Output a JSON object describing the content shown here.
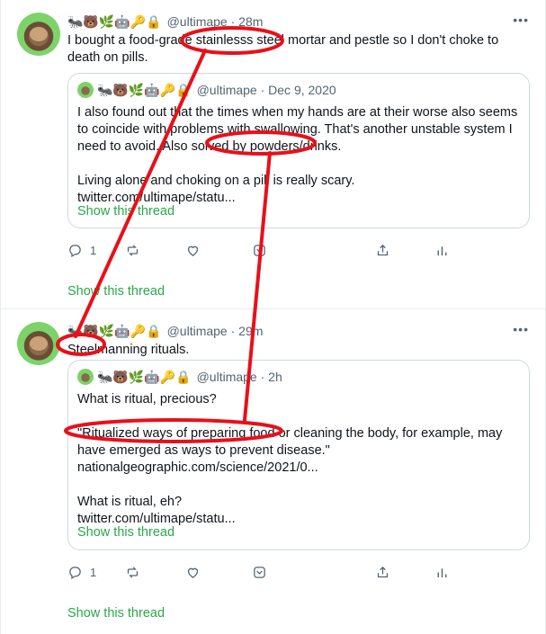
{
  "tweets": [
    {
      "emojis": "🐜🐻🌿🤖🔑🔒",
      "handle": "@ultimape",
      "time": "· 28m",
      "more": "•••",
      "text": "I bought a food-grade stainlesss steel mortar and pestle so I don't choke to death on pills.",
      "quote": {
        "emojis": "🐜🐻🌿🤖🔑🔒",
        "handle": "@ultimape · Dec 9, 2020",
        "paragraphs": [
          "I also found out that the times when my hands are at their worse also seems to coincide with problems with swallowing. That's another unstable system I need to avoid. Also solved by powders/drinks.",
          "Living alone and choking on a pill is really scary.\ntwitter.com/ultimape/statu..."
        ],
        "show_thread": "Show this thread"
      },
      "reply_count": "1",
      "show_thread": "Show this thread"
    },
    {
      "emojis": "🐜🐻🌿🤖🔑🔒",
      "handle": "@ultimape",
      "time": "· 29m",
      "more": "•••",
      "text": "Steelmanning rituals.",
      "quote": {
        "emojis": "🐜🐻🌿🤖🔑🔒",
        "handle": "@ultimape · 2h",
        "paragraphs": [
          "What is ritual, precious?",
          "\"Ritualized ways of preparing food or cleaning the body, for example, may have emerged as ways to prevent disease.\"\nnationalgeographic.com/science/2021/0...",
          "What is ritual, eh?\ntwitter.com/ultimape/statu..."
        ],
        "show_thread": "Show this thread"
      },
      "reply_count": "1",
      "show_thread": "Show this thread"
    }
  ],
  "annotation_color": "#e8101a"
}
